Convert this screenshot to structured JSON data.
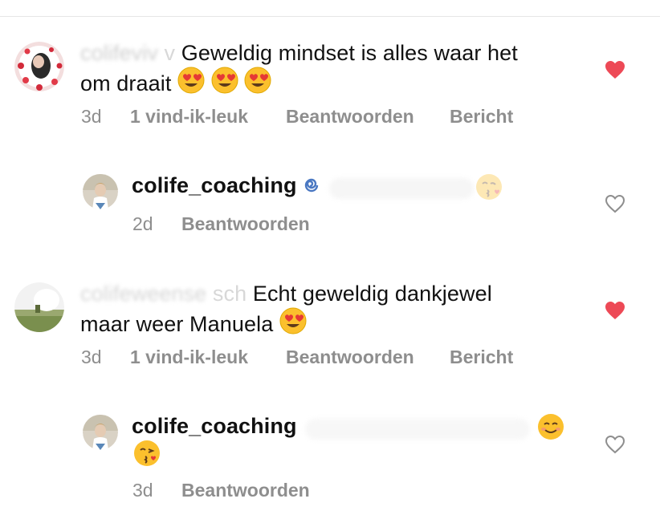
{
  "comments": [
    {
      "username_blurred": "v",
      "text_line1": "Geweldig mindset is alles waar het",
      "text_line2": "om draait",
      "time": "3d",
      "likes": "1 vind-ik-leuk",
      "reply": "Beantwoorden",
      "message": "Bericht",
      "liked": true,
      "heart_color": "#ed4956"
    },
    {
      "username": "colife_coaching",
      "time": "2d",
      "reply": "Beantwoorden",
      "liked": false
    },
    {
      "username_blurred": "sch",
      "text_line1": "Echt geweldig dankjewel",
      "text_line2": "maar weer Manuela",
      "time": "3d",
      "likes": "1 vind-ik-leuk",
      "reply": "Beantwoorden",
      "message": "Bericht",
      "liked": true
    },
    {
      "username": "colife_coaching",
      "time": "3d",
      "reply": "Beantwoorden",
      "liked": false
    }
  ],
  "colors": {
    "liked_heart": "#ed4956",
    "meta_text": "#8e8e8e"
  },
  "icons": [
    "heart-eyes-emoji",
    "kissing-emoji",
    "smiling-emoji",
    "heart-icon",
    "heart-outline-icon"
  ]
}
